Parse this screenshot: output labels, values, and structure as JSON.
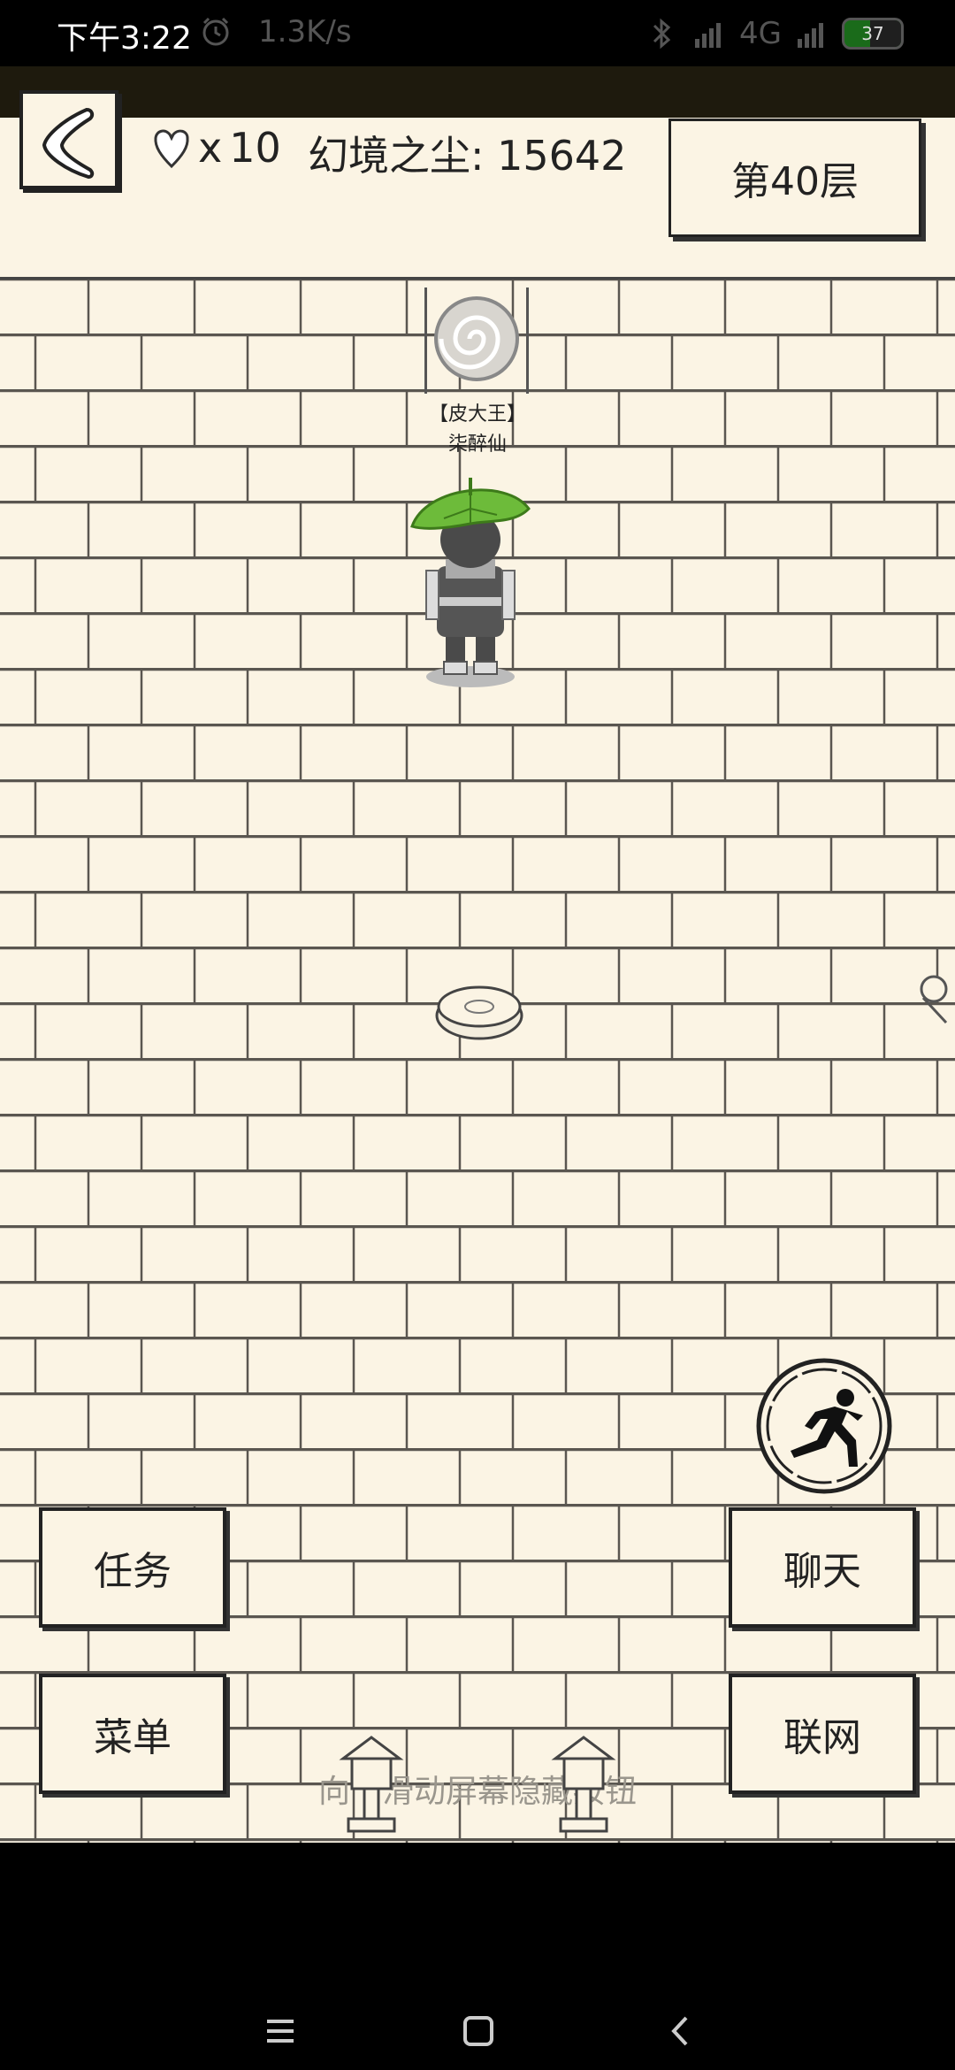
{
  "status_bar": {
    "time": "下午3:22",
    "net_speed": "1.3K/s",
    "network": "4G",
    "battery": "37"
  },
  "hud": {
    "lives_prefix": "x",
    "lives": "10",
    "dust_label": "幻境之尘: 15642",
    "floor": "第40层"
  },
  "player": {
    "title": "【皮大王】",
    "name": "柒醉仙"
  },
  "buttons": {
    "task": "任务",
    "menu": "菜单",
    "chat": "聊天",
    "network": "联网"
  },
  "hint": "向下滑动屏幕隐藏按钮",
  "colors": {
    "paper": "#fbf4e4",
    "ink": "#222222",
    "leaf": "#6dbb3a"
  }
}
